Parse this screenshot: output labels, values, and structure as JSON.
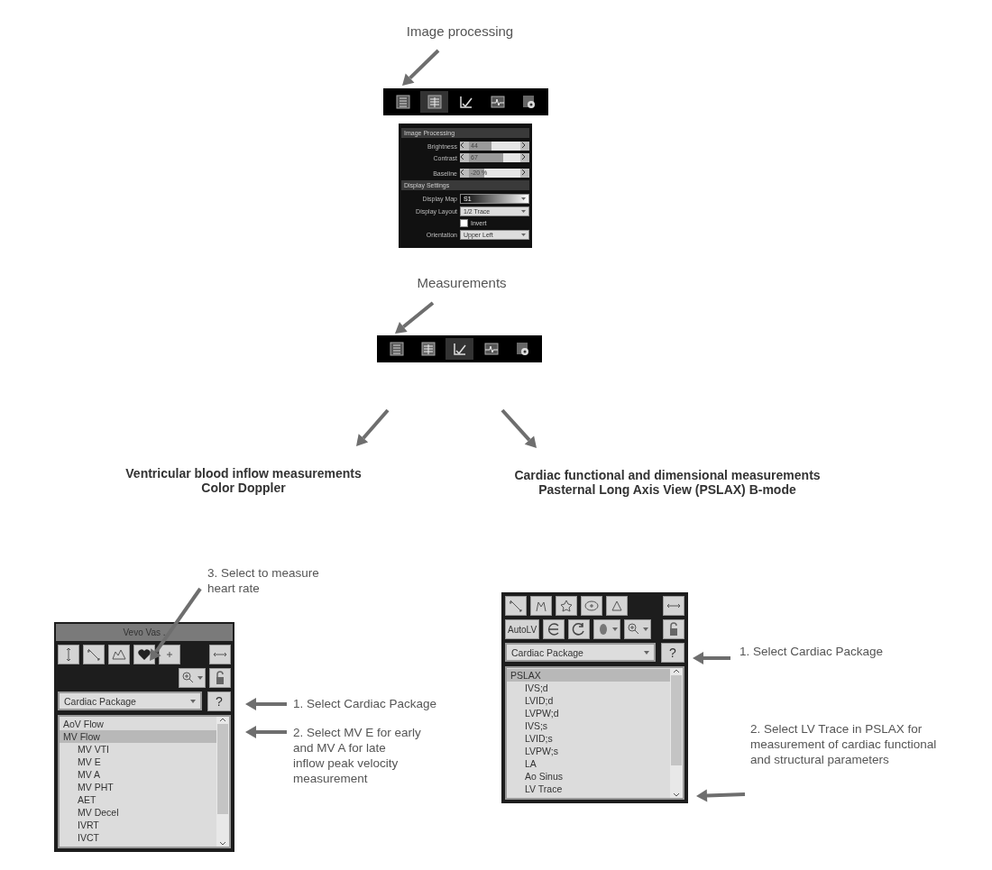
{
  "image_processing": {
    "heading": "Image processing",
    "toolbar": [
      {
        "selected": false
      },
      {
        "selected": true
      },
      {
        "selected": false
      },
      {
        "selected": false
      },
      {
        "selected": false
      }
    ],
    "panel": [
      {
        "title": "Image Processing",
        "rows": [
          {
            "kind": "slider",
            "label": "Brightness",
            "reading": "44",
            "level": 0.44
          },
          {
            "kind": "slider",
            "label": "Contrast",
            "reading": "67",
            "level": 0.67
          },
          {
            "kind": "slider",
            "label": "Baseline",
            "reading": "-20 %",
            "level": 0.3
          }
        ]
      },
      {
        "title": "Display Settings",
        "rows": [
          {
            "kind": "colormap",
            "label": "Display Map",
            "value": "S1"
          },
          {
            "kind": "dropdown",
            "label": "Display Layout",
            "value": "1/2 Trace"
          },
          {
            "kind": "checkbox",
            "label": "Invert",
            "checked": false
          },
          {
            "kind": "dropdown",
            "label": "Orientation",
            "value": "Upper Left"
          }
        ]
      }
    ]
  },
  "measurements": {
    "heading": "Measurements",
    "toolbar": [
      {
        "selected": false
      },
      {
        "selected": false
      },
      {
        "selected": true
      },
      {
        "selected": false
      },
      {
        "selected": false
      }
    ]
  },
  "left": {
    "caption": [
      "Ventricular blood inflow measurements",
      "Color Doppler"
    ],
    "note_top": [
      "3. Select to measure",
      "heart rate"
    ],
    "panel": {
      "title": "Vevo Vas .",
      "dropdown": "Cardiac Package",
      "help": "?",
      "items": [
        {
          "label": "AoV Flow",
          "selected": false
        },
        {
          "label": "MV Flow",
          "selected": true,
          "children": [
            {
              "label": "MV VTI",
              "selected": false
            },
            {
              "label": "MV E",
              "selected": false
            },
            {
              "label": "MV A",
              "selected": false
            },
            {
              "label": "MV PHT",
              "selected": false
            },
            {
              "label": "AET",
              "selected": false
            },
            {
              "label": "MV Decel",
              "selected": false
            },
            {
              "label": "IVRT",
              "selected": false
            },
            {
              "label": "IVCT",
              "selected": false
            }
          ]
        }
      ]
    },
    "notes": [
      [
        "1. Select Cardiac Package"
      ],
      [
        "2. Select MV E for early",
        "and MV A for late",
        "inflow peak velocity",
        "measurement"
      ]
    ]
  },
  "right": {
    "caption": [
      "Cardiac functional and dimensional measurements",
      "Pasternal Long Axis View (PSLAX) B-mode"
    ],
    "panel": {
      "auto_button": "AutoLV",
      "dropdown": "Cardiac Package",
      "help": "?",
      "items": [
        {
          "label": "PSLAX",
          "selected": true,
          "children": [
            {
              "label": "IVS;d",
              "selected": false
            },
            {
              "label": "LVID;d",
              "selected": false
            },
            {
              "label": "LVPW;d",
              "selected": false
            },
            {
              "label": "IVS;s",
              "selected": false
            },
            {
              "label": "LVID;s",
              "selected": false
            },
            {
              "label": "LVPW;s",
              "selected": false
            },
            {
              "label": "LA",
              "selected": false
            },
            {
              "label": "Ao Sinus",
              "selected": false
            },
            {
              "label": "LV Trace",
              "selected": false
            }
          ]
        }
      ]
    },
    "notes": [
      [
        "1. Select Cardiac Package"
      ],
      [
        "2. Select LV Trace in PSLAX for",
        "measurement of cardiac functional",
        "and structural parameters"
      ]
    ]
  }
}
